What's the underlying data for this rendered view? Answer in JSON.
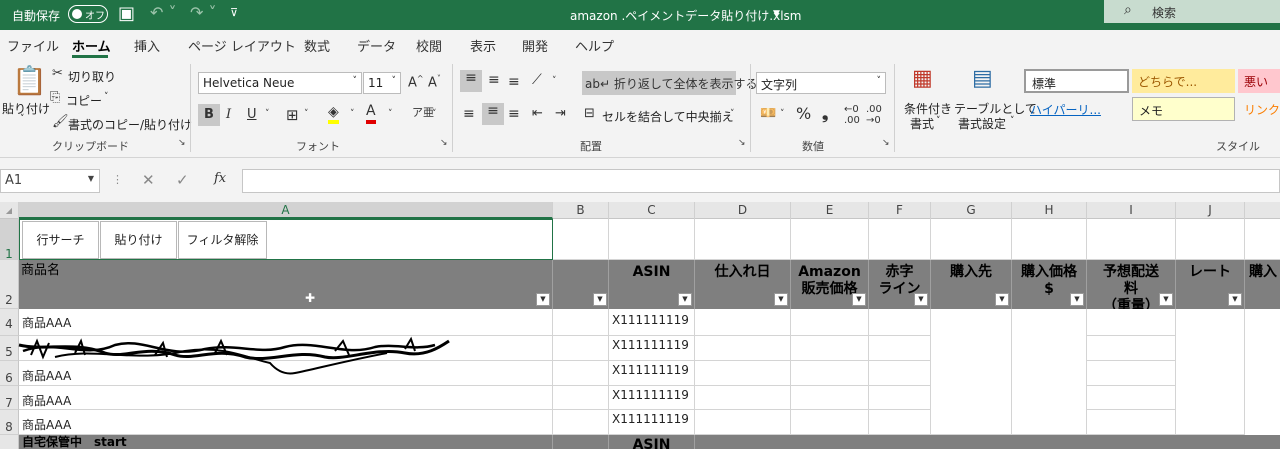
{
  "titlebar": {
    "autosave_label": "自動保存",
    "toggle_state": "オフ",
    "filename": "amazon .ペイメントデータ貼り付け.xlsm",
    "search_label": "検索"
  },
  "tabs": [
    "ファイル",
    "ホーム",
    "挿入",
    "ページ レイアウト",
    "数式",
    "データ",
    "校閲",
    "表示",
    "開発",
    "ヘルプ"
  ],
  "ribbon": {
    "clipboard": {
      "paste": "貼り付け",
      "cut": "切り取り",
      "copy": "コピー",
      "format_painter": "書式のコピー/貼り付け",
      "group": "クリップボード"
    },
    "font": {
      "name": "Helvetica Neue",
      "size": "11",
      "bold": "B",
      "italic": "I",
      "underline": "U",
      "group": "フォント"
    },
    "alignment": {
      "wrap": "折り返して全体を表示する",
      "merge": "セルを結合して中央揃え",
      "group": "配置"
    },
    "number": {
      "format": "文字列",
      "group": "数値"
    },
    "styles": {
      "conditional": "条件付き",
      "conditional2": "書式",
      "table": "テーブルとして",
      "table2": "書式設定",
      "group": "スタイル",
      "items": {
        "normal": "標準",
        "neutral": "どちらで...",
        "bad": "悪い",
        "hyperlink": "ハイパーリ...",
        "memo": "メモ",
        "link": "リンク"
      }
    }
  },
  "formula_bar": {
    "name_box": "A1",
    "fx": "fx",
    "formula": ""
  },
  "columns": [
    "A",
    "B",
    "C",
    "D",
    "E",
    "F",
    "G",
    "H",
    "I",
    "J"
  ],
  "buttons": {
    "row_search": "行サーチ",
    "paste": "貼り付け",
    "clear_filter": "フィルタ解除"
  },
  "headers": {
    "A": "商品名",
    "C": "ASIN",
    "D": "仕入れ日",
    "E1": "Amazon",
    "E2": "販売価格",
    "F1": "赤字",
    "F2": "ライン",
    "G": "購入先",
    "H1": "購入価格",
    "H2": "$",
    "I1": "予想配送",
    "I2": "料",
    "I3": "（重量）",
    "J": "レート",
    "K": "購入"
  },
  "rows": [
    {
      "num": "4",
      "name": "商品AAA",
      "asin": "X111111119"
    },
    {
      "num": "5",
      "name": "",
      "asin": "X111111119"
    },
    {
      "num": "6",
      "name": "商品AAA",
      "asin": "X111111119"
    },
    {
      "num": "7",
      "name": "商品AAA",
      "asin": "X111111119"
    },
    {
      "num": "8",
      "name": "商品AAA",
      "asin": "X111111119"
    }
  ],
  "row_numbers": {
    "r1": "1",
    "r2": "2"
  },
  "section_row": {
    "label": "自宅保管中　start",
    "asin": "ASIN"
  }
}
